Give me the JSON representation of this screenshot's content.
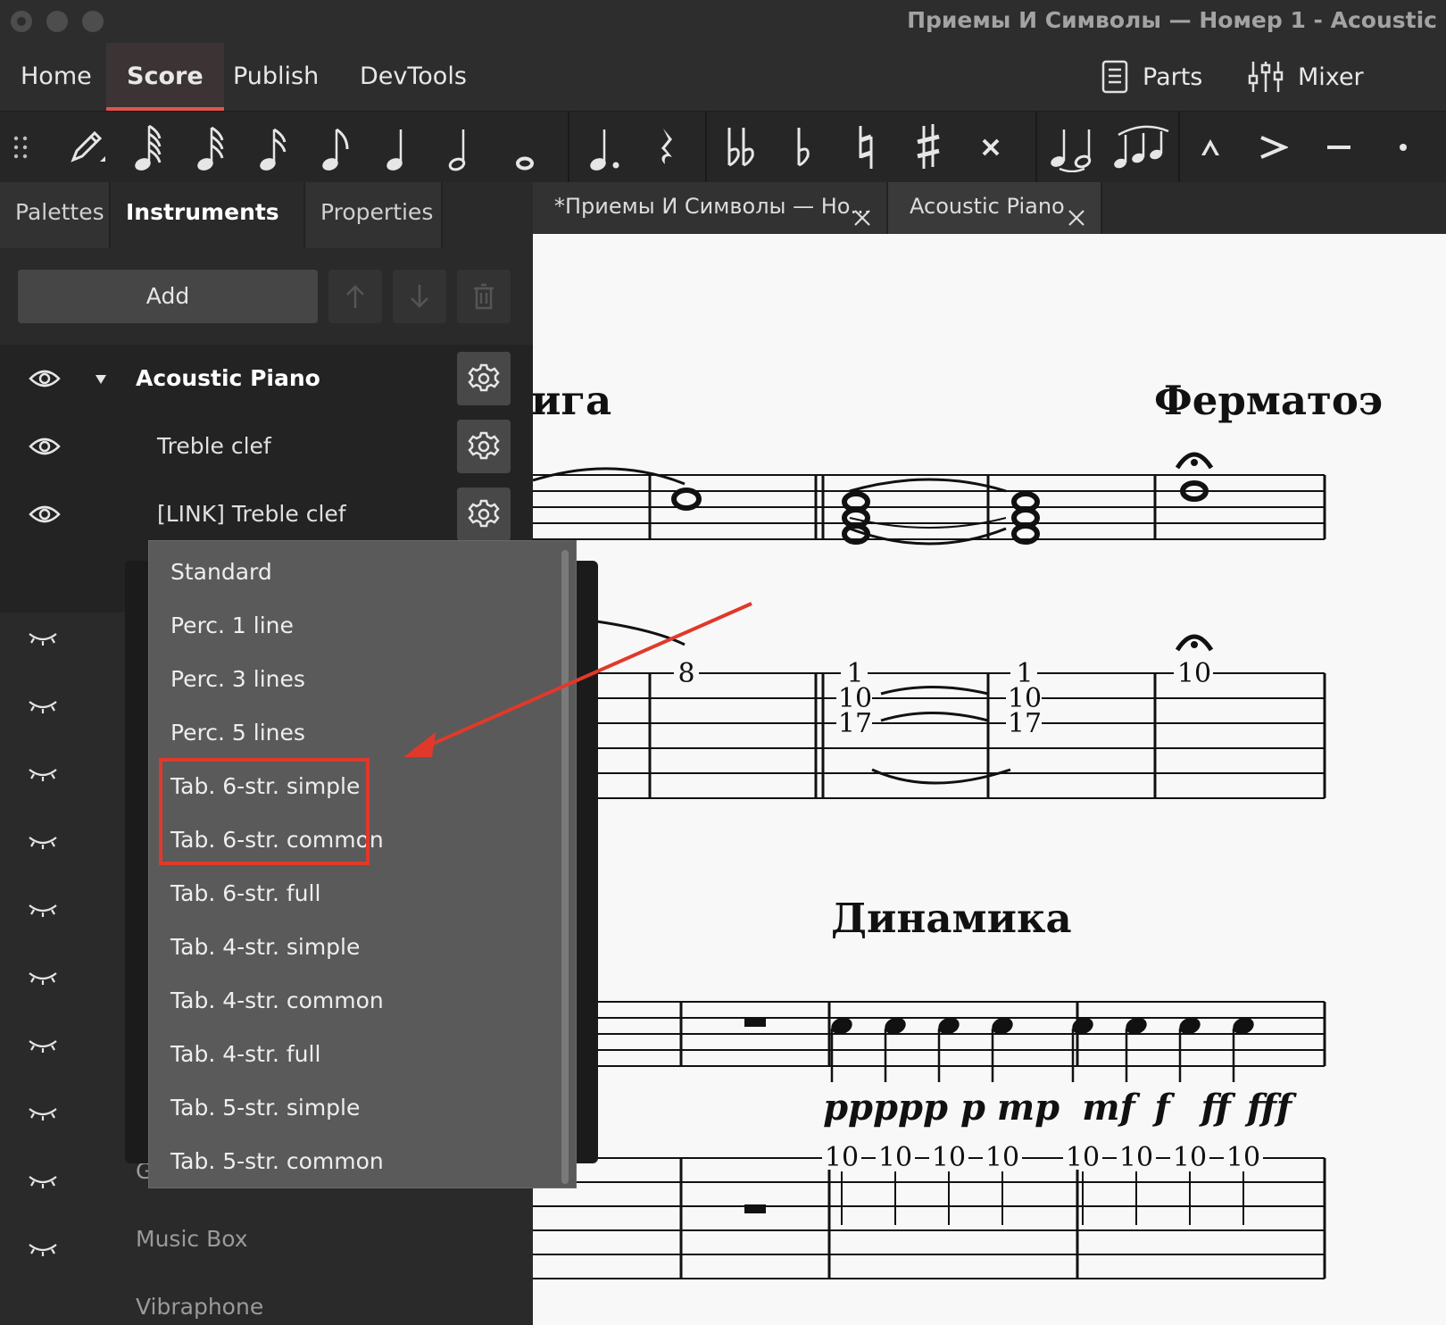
{
  "window": {
    "title": "Приемы И Символы — Номер 1 - Acoustic"
  },
  "menubar": {
    "tabs": [
      "Home",
      "Score",
      "Publish",
      "DevTools"
    ],
    "active_tab": "Score",
    "parts_label": "Parts",
    "mixer_label": "Mixer"
  },
  "toolbar": {
    "items": [
      "drag-handle-icon",
      "note-input-pencil-icon",
      "64th-note-icon",
      "32nd-note-icon",
      "16th-note-icon",
      "eighth-note-icon",
      "quarter-note-icon",
      "half-note-icon",
      "whole-note-icon",
      "augmentation-dot-icon",
      "rest-icon",
      "double-flat-icon",
      "flat-icon",
      "natural-icon",
      "sharp-icon",
      "double-sharp-icon",
      "tie-icon",
      "slur-icon",
      "marcato-icon",
      "accent-icon",
      "tenuto-icon",
      "staccato-icon"
    ]
  },
  "panel": {
    "tabs": [
      "Palettes",
      "Instruments",
      "Properties"
    ],
    "active_tab": "Instruments",
    "more_label": "···",
    "add_label": "Add"
  },
  "instruments": [
    {
      "name": "Acoustic Piano",
      "visible": true,
      "expanded": true,
      "level": 0
    },
    {
      "name": "Treble clef",
      "visible": true,
      "level": 1
    },
    {
      "name": "[LINK] Treble clef",
      "visible": true,
      "level": 1
    }
  ],
  "hidden_instruments": [
    "Glockenspiel",
    "Music Box",
    "Vibraphone"
  ],
  "doc_tabs": [
    {
      "label": "*Приемы И Символы — Но...",
      "active": true
    },
    {
      "label": "Acoustic Piano",
      "active": false
    }
  ],
  "dropdown": {
    "options": [
      "Standard",
      "Perc. 1 line",
      "Perc. 3 lines",
      "Perc. 5 lines",
      "Tab. 6-str. simple",
      "Tab. 6-str. common",
      "Tab. 6-str. full",
      "Tab. 4-str. simple",
      "Tab. 4-str. common",
      "Tab. 4-str. full",
      "Tab. 5-str. simple",
      "Tab. 5-str. common"
    ],
    "highlighted": [
      "Tab. 6-str. simple",
      "Tab. 6-str. common"
    ]
  },
  "score": {
    "headings": {
      "left_fragment": "ига",
      "fermata": "Ферматоэ",
      "dynamics": "Динамика"
    },
    "tab_numbers_row1": {
      "m1": "8",
      "chord": [
        "1",
        "10",
        "17"
      ],
      "fermata": "10"
    },
    "dynamics_marks": [
      "ppppp",
      "p",
      "mp",
      "mf",
      "f",
      "ff",
      "fff"
    ],
    "tab_numbers_row2": [
      "10",
      "10",
      "10",
      "10",
      "10",
      "10",
      "10",
      "10"
    ]
  },
  "colors": {
    "accent": "#e3544b",
    "annotation": "#e0392b",
    "panel_bg": "#2a2a2a",
    "score_bg": "#f8f8f8"
  }
}
